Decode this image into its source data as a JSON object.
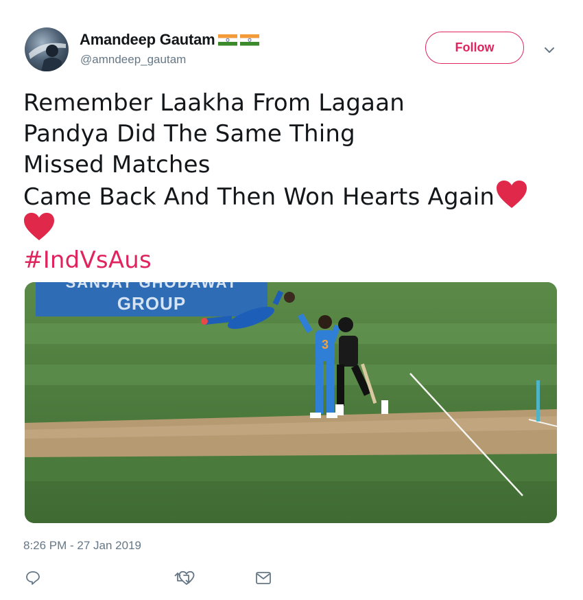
{
  "user": {
    "display_name": "Amandeep Gautam",
    "handle": "@amndeep_gautam",
    "flags": [
      "india-flag-icon",
      "india-flag-icon"
    ]
  },
  "follow_button": {
    "label": "Follow"
  },
  "tweet": {
    "lines": [
      "Remember Laakha From Lagaan",
      "Pandya Did The Same Thing",
      "Missed Matches",
      "Came Back And Then Won Hearts Again"
    ],
    "hashtag": "#IndVsAus",
    "emoji": [
      "red-heart-icon",
      "red-heart-icon"
    ]
  },
  "media": {
    "type": "photo",
    "banner_text": "GROUP",
    "banner_text_partial": "SANJAY GHODAWAT",
    "player_number": "3"
  },
  "timestamp": "8:26 PM - 27 Jan 2019",
  "actions": [
    "reply-icon",
    "retweet-icon",
    "like-icon",
    "direct-message-icon"
  ],
  "colors": {
    "accent": "#e0245e",
    "text": "#14171a",
    "secondary": "#657786",
    "heart": "#e0294a"
  }
}
